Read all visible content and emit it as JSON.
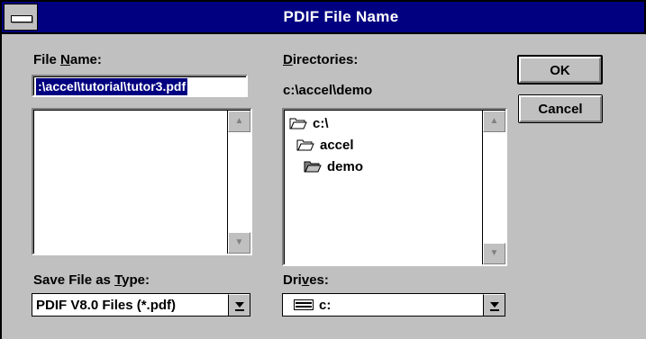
{
  "window": {
    "title": "PDIF File Name"
  },
  "labels": {
    "file_name_pre": "File ",
    "file_name_u": "N",
    "file_name_post": "ame:",
    "directories_u": "D",
    "directories_post": "irectories:",
    "current_dir": "c:\\accel\\demo",
    "save_type_pre": "Save File as ",
    "save_type_u": "T",
    "save_type_post": "ype:",
    "drives_pre": "Dri",
    "drives_u": "v",
    "drives_post": "es:"
  },
  "file_name": {
    "value": ":\\accel\\tutorial\\tutor3.pdf"
  },
  "directories": [
    {
      "label": "c:\\",
      "state": "open"
    },
    {
      "label": "accel",
      "state": "open"
    },
    {
      "label": "demo",
      "state": "open-selected"
    }
  ],
  "save_type": {
    "selected": "PDIF V8.0 Files (*.pdf)"
  },
  "drives": {
    "selected": "c:"
  },
  "buttons": {
    "ok": "OK",
    "cancel": "Cancel"
  },
  "icons": {
    "system_menu": "system-menu-icon",
    "scroll_up": "scroll-up-arrow-icon",
    "scroll_down": "scroll-down-arrow-icon",
    "folder_open": "open-folder-icon",
    "drive": "hard-drive-icon",
    "dropdown": "dropdown-arrow-icon"
  },
  "colors": {
    "titlebar": "#000080",
    "face": "#c0c0c0",
    "selection": "#000080"
  }
}
